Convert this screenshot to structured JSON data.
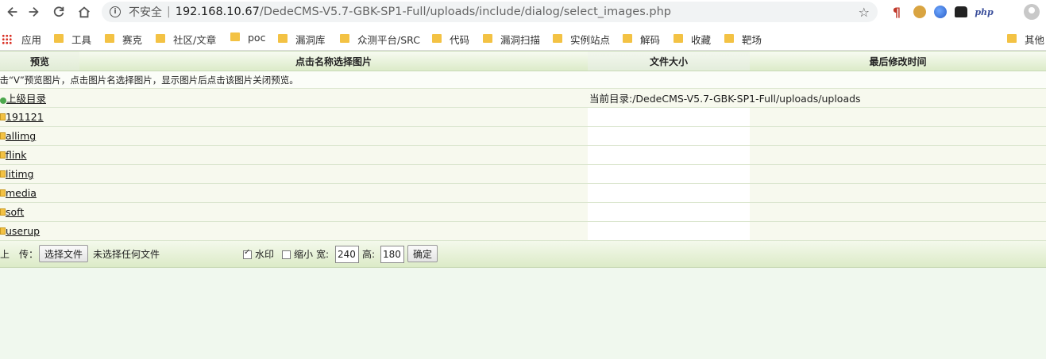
{
  "browser": {
    "security_label": "不安全",
    "separator": "|",
    "url_host": "192.168.10.67",
    "url_path": "/DedeCMS-V5.7-GBK-SP1-Full/uploads/include/dialog/select_images.php",
    "ext_php_label": "php"
  },
  "bookmarks": [
    {
      "label": "应用",
      "icon": "apps-grid-icon"
    },
    {
      "label": "工具",
      "icon": "folder-icon"
    },
    {
      "label": "赛克",
      "icon": "folder-icon"
    },
    {
      "label": "社区/文章",
      "icon": "folder-icon"
    },
    {
      "label": "poc",
      "icon": "folder-icon"
    },
    {
      "label": "漏洞库",
      "icon": "folder-icon"
    },
    {
      "label": "众测平台/SRC",
      "icon": "folder-icon"
    },
    {
      "label": "代码",
      "icon": "folder-icon"
    },
    {
      "label": "漏洞扫描",
      "icon": "folder-icon"
    },
    {
      "label": "实例站点",
      "icon": "folder-icon"
    },
    {
      "label": "解码",
      "icon": "folder-icon"
    },
    {
      "label": "收藏",
      "icon": "folder-icon"
    },
    {
      "label": "靶场",
      "icon": "folder-icon"
    },
    {
      "label": "其他",
      "icon": "folder-icon"
    }
  ],
  "table": {
    "headers": {
      "preview": "预览",
      "name": "点击名称选择图片",
      "size": "文件大小",
      "modified": "最后修改时间"
    },
    "hint": "点击“V”预览图片，点击图片名选择图片，显示图片后点击该图片关闭预览。",
    "parent": {
      "label": "上级目录",
      "current_dir": "当前目录:/DedeCMS-V5.7-GBK-SP1-Full/uploads/uploads"
    },
    "folders": [
      "191121",
      "allimg",
      "flink",
      "litimg",
      "media",
      "soft",
      "userup"
    ]
  },
  "upload": {
    "label": "上　传：",
    "choose_file": "选择文件",
    "no_file": "未选择任何文件",
    "watermark_label": "水印",
    "watermark_checked": true,
    "shrink_label": "缩小",
    "shrink_checked": false,
    "width_label": "宽:",
    "width_value": "240",
    "height_label": "高:",
    "height_value": "180",
    "confirm": "确定"
  },
  "colors": {
    "page_bg": "#f0f8ee",
    "header_gradient_bottom": "#dcebc9",
    "row_bg": "#f7f9ee",
    "folder_yellow": "#f3c244"
  }
}
